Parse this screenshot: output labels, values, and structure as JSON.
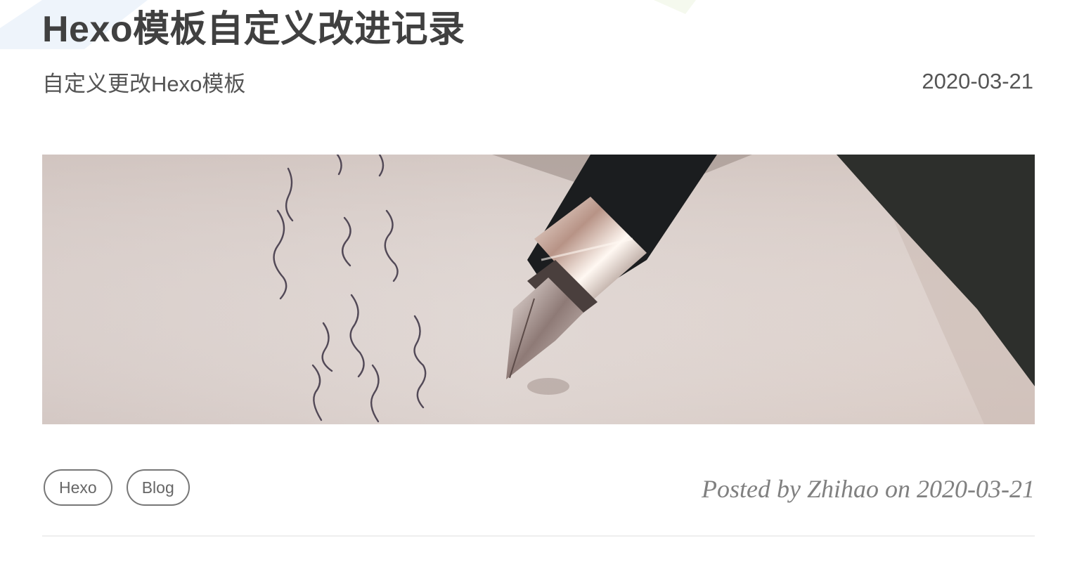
{
  "post": {
    "title": "Hexo模板自定义改进记录",
    "subtitle": "自定义更改Hexo模板",
    "date": "2020-03-21",
    "cover_image": "fountain-pen-writing-icon",
    "tags": [
      "Hexo",
      "Blog"
    ],
    "meta": "Posted by Zhihao on 2020-03-21"
  },
  "colors": {
    "title": "#404040",
    "subtitle": "#555555",
    "meta": "#808080",
    "tag_border": "#777777",
    "divider": "#eeeeee"
  }
}
